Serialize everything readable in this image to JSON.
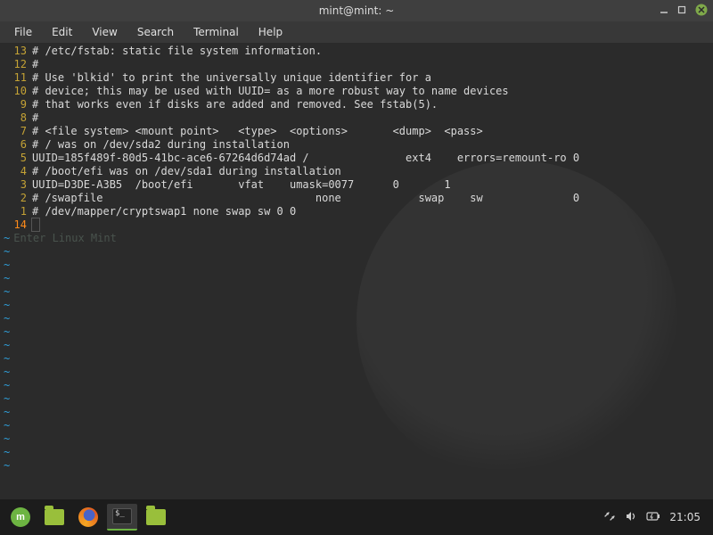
{
  "titlebar": {
    "text": "mint@mint: ~"
  },
  "menu": {
    "items": [
      "File",
      "Edit",
      "View",
      "Search",
      "Terminal",
      "Help"
    ]
  },
  "editor": {
    "rel_numbers": [
      "13",
      "12",
      "11",
      "10",
      "9",
      "8",
      "7",
      "6",
      "5",
      "4",
      "3",
      "2",
      "1"
    ],
    "current_number": "14",
    "lines": [
      "# /etc/fstab: static file system information.",
      "#",
      "# Use 'blkid' to print the universally unique identifier for a",
      "# device; this may be used with UUID= as a more robust way to name devices",
      "# that works even if disks are added and removed. See fstab(5).",
      "#",
      "# <file system> <mount point>   <type>  <options>       <dump>  <pass>",
      "# / was on /dev/sda2 during installation",
      "UUID=185f489f-80d5-41bc-ace6-67264d6d74ad /               ext4    errors=remount-ro 0",
      "# /boot/efi was on /dev/sda1 during installation",
      "UUID=D3DE-A3B5  /boot/efi       vfat    umask=0077      0       1",
      "# /swapfile                                 none            swap    sw              0",
      "# /dev/mapper/cryptswap1 none swap sw 0 0"
    ],
    "ghost_text": "Enter Linux Mint",
    "tilde": "~"
  },
  "panel": {
    "clock": "21:05"
  }
}
